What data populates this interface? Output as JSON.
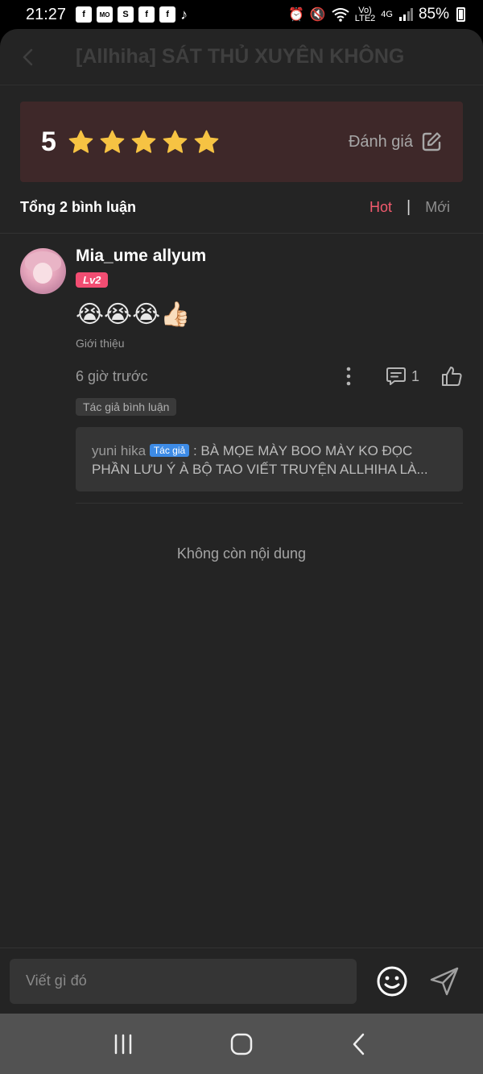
{
  "status_bar": {
    "time": "21:27",
    "notif_icons": [
      "facebook-icon",
      "momo-icon",
      "shopee-icon",
      "facebook-icon",
      "facebook-icon",
      "tiktok-icon"
    ],
    "network_top": "Vo)",
    "network_bottom": "LTE2",
    "signal_top": "4G",
    "battery": "85%"
  },
  "header": {
    "title": "[Allhiha] SÁT THỦ XUYÊN KHÔNG"
  },
  "rating": {
    "score": "5",
    "stars": 5,
    "rate_label": "Đánh giá",
    "star_color": "#f6c343"
  },
  "summary": {
    "total_label": "Tổng 2 bình luận",
    "sort_hot": "Hot",
    "sort_separator": "|",
    "sort_new": "Mới"
  },
  "comment": {
    "username": "Mia_ume allyum",
    "level": "Lv2",
    "content": "😭😭😭👍🏻",
    "intro_label": "Giới thiệu",
    "time_ago": "6 giờ trước",
    "reply_count": "1",
    "author_tag": "Tác giả bình luận",
    "reply": {
      "name": "yuni hika",
      "tag": "Tác giả",
      "text": ": BÀ MỌE MÀY BOO MÀY KO ĐỌC PHẦN LƯU Ý À BỘ TAO VIẾT TRUYỆN ALLHIHA LÀ..."
    }
  },
  "end_label": "Không còn nội dung",
  "composer": {
    "placeholder": "Viết gì đó"
  },
  "colors": {
    "accent": "#f25a6e",
    "card_bg": "#3e2829",
    "author_tag_blue": "#3d8be6"
  }
}
